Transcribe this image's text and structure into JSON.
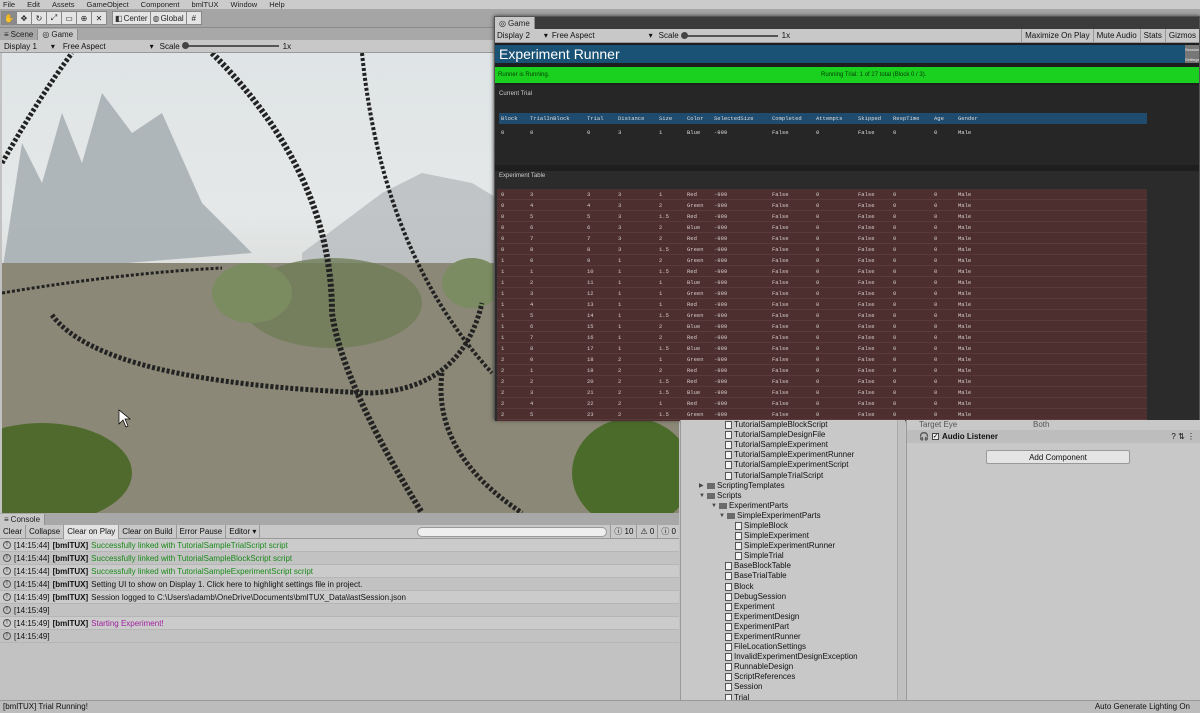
{
  "menu": [
    "File",
    "Edit",
    "Assets",
    "GameObject",
    "Component",
    "bmlTUX",
    "Window",
    "Help"
  ],
  "toolbar": {
    "center": "Center",
    "global": "Global"
  },
  "scene": {
    "tabs": [
      "Scene",
      "Game"
    ],
    "display": "Display 1",
    "aspect": "Free Aspect",
    "scale_label": "Scale",
    "scale_value": "1x"
  },
  "game": {
    "tab": "Game",
    "display": "Display 2",
    "aspect": "Free Aspect",
    "scale_label": "Scale",
    "scale_value": "1x",
    "buttons": [
      "Maximize On Play",
      "Mute Audio",
      "Stats",
      "Gizmos"
    ],
    "title": "Experiment Runner",
    "settings_btn": "Session Settings",
    "status_left": "Runner is Running.",
    "status_center": "Running Trial: 1 of 27 total (Block 0 / 3).",
    "current_trial_label": "Current Trial",
    "experiment_table_label": "Experiment Table",
    "columns": [
      "Block",
      "TrialInBlock",
      "Trial",
      "Distance",
      "Size",
      "Color",
      "SelectedSize",
      "Completed",
      "Attempts",
      "Skipped",
      "RespTime",
      "Age",
      "Gender"
    ],
    "current_row": [
      "0",
      "0",
      "0",
      "3",
      "1",
      "Blue",
      "-999",
      "False",
      "0",
      "False",
      "0",
      "0",
      "Male"
    ],
    "table_rows": [
      [
        "0",
        "3",
        "3",
        "3",
        "1",
        "Red",
        "-999",
        "False",
        "0",
        "False",
        "0",
        "0",
        "Male"
      ],
      [
        "0",
        "4",
        "4",
        "3",
        "2",
        "Green",
        "-999",
        "False",
        "0",
        "False",
        "0",
        "0",
        "Male"
      ],
      [
        "0",
        "5",
        "5",
        "3",
        "1.5",
        "Red",
        "-999",
        "False",
        "0",
        "False",
        "0",
        "0",
        "Male"
      ],
      [
        "0",
        "6",
        "6",
        "3",
        "2",
        "Blue",
        "-999",
        "False",
        "0",
        "False",
        "0",
        "0",
        "Male"
      ],
      [
        "0",
        "7",
        "7",
        "3",
        "2",
        "Red",
        "-999",
        "False",
        "0",
        "False",
        "0",
        "0",
        "Male"
      ],
      [
        "0",
        "8",
        "8",
        "3",
        "1.5",
        "Green",
        "-999",
        "False",
        "0",
        "False",
        "0",
        "0",
        "Male"
      ],
      [
        "1",
        "0",
        "9",
        "1",
        "2",
        "Green",
        "-999",
        "False",
        "0",
        "False",
        "0",
        "0",
        "Male"
      ],
      [
        "1",
        "1",
        "10",
        "1",
        "1.5",
        "Red",
        "-999",
        "False",
        "0",
        "False",
        "0",
        "0",
        "Male"
      ],
      [
        "1",
        "2",
        "11",
        "1",
        "1",
        "Blue",
        "-999",
        "False",
        "0",
        "False",
        "0",
        "0",
        "Male"
      ],
      [
        "1",
        "3",
        "12",
        "1",
        "1",
        "Green",
        "-999",
        "False",
        "0",
        "False",
        "0",
        "0",
        "Male"
      ],
      [
        "1",
        "4",
        "13",
        "1",
        "1",
        "Red",
        "-999",
        "False",
        "0",
        "False",
        "0",
        "0",
        "Male"
      ],
      [
        "1",
        "5",
        "14",
        "1",
        "1.5",
        "Green",
        "-999",
        "False",
        "0",
        "False",
        "0",
        "0",
        "Male"
      ],
      [
        "1",
        "6",
        "15",
        "1",
        "2",
        "Blue",
        "-999",
        "False",
        "0",
        "False",
        "0",
        "0",
        "Male"
      ],
      [
        "1",
        "7",
        "16",
        "1",
        "2",
        "Red",
        "-999",
        "False",
        "0",
        "False",
        "0",
        "0",
        "Male"
      ],
      [
        "1",
        "8",
        "17",
        "1",
        "1.5",
        "Blue",
        "-999",
        "False",
        "0",
        "False",
        "0",
        "0",
        "Male"
      ],
      [
        "2",
        "0",
        "18",
        "2",
        "1",
        "Green",
        "-999",
        "False",
        "0",
        "False",
        "0",
        "0",
        "Male"
      ],
      [
        "2",
        "1",
        "19",
        "2",
        "2",
        "Red",
        "-999",
        "False",
        "0",
        "False",
        "0",
        "0",
        "Male"
      ],
      [
        "2",
        "2",
        "20",
        "2",
        "1.5",
        "Red",
        "-999",
        "False",
        "0",
        "False",
        "0",
        "0",
        "Male"
      ],
      [
        "2",
        "3",
        "21",
        "2",
        "1.5",
        "Blue",
        "-999",
        "False",
        "0",
        "False",
        "0",
        "0",
        "Male"
      ],
      [
        "2",
        "4",
        "22",
        "2",
        "1",
        "Red",
        "-999",
        "False",
        "0",
        "False",
        "0",
        "0",
        "Male"
      ],
      [
        "2",
        "5",
        "23",
        "2",
        "1.5",
        "Green",
        "-999",
        "False",
        "0",
        "False",
        "0",
        "0",
        "Male"
      ]
    ]
  },
  "console": {
    "tab": "Console",
    "buttons": [
      "Clear",
      "Collapse",
      "Clear on Play",
      "Clear on Build",
      "Error Pause",
      "Editor"
    ],
    "counts": [
      "10",
      "0",
      "0"
    ],
    "lines": [
      {
        "time": "[14:15:44]",
        "tag": "[bmlTUX]",
        "msg": "Successfully linked with TutorialSampleTrialScript script",
        "color": "#1a8a1a"
      },
      {
        "time": "[14:15:44]",
        "tag": "[bmlTUX]",
        "msg": "Successfully linked with TutorialSampleBlockScript script",
        "color": "#1a8a1a"
      },
      {
        "time": "[14:15:44]",
        "tag": "[bmlTUX]",
        "msg": "Successfully linked with TutorialSampleExperimentScript script",
        "color": "#1a8a1a"
      },
      {
        "time": "[14:15:44]",
        "tag": "[bmlTUX]",
        "msg": "Setting UI to show on Display 1. Click here to highlight settings file in project.",
        "color": "#111111"
      },
      {
        "time": "[14:15:49]",
        "tag": "[bmlTUX]",
        "msg": "Session logged to C:\\Users\\adamb\\OneDrive\\Documents\\bmlTUX_Data\\lastSession.json",
        "color": "#111111"
      },
      {
        "time": "[14:15:49]",
        "tag": "",
        "msg": "",
        "color": "#111111"
      },
      {
        "time": "[14:15:49]",
        "tag": "[bmlTUX]",
        "msg": "Starting Experiment!",
        "color": "#a020a0"
      },
      {
        "time": "[14:15:49]",
        "tag": "",
        "msg": "",
        "color": "#111111"
      }
    ]
  },
  "project": {
    "items": [
      {
        "label": "TutorialSampleBlockScript",
        "indent": 44,
        "kind": "file"
      },
      {
        "label": "TutorialSampleDesignFile",
        "indent": 44,
        "kind": "file"
      },
      {
        "label": "TutorialSampleExperiment",
        "indent": 44,
        "kind": "file"
      },
      {
        "label": "TutorialSampleExperimentRunner",
        "indent": 44,
        "kind": "file"
      },
      {
        "label": "TutorialSampleExperimentScript",
        "indent": 44,
        "kind": "file"
      },
      {
        "label": "TutorialSampleTrialScript",
        "indent": 44,
        "kind": "file"
      },
      {
        "label": "ScriptingTemplates",
        "indent": 18,
        "kind": "folder",
        "arrow": "▶"
      },
      {
        "label": "Scripts",
        "indent": 18,
        "kind": "folder",
        "arrow": "▼"
      },
      {
        "label": "ExperimentParts",
        "indent": 30,
        "kind": "folder",
        "arrow": "▼"
      },
      {
        "label": "SimpleExperimentParts",
        "indent": 38,
        "kind": "folder",
        "arrow": "▼"
      },
      {
        "label": "SimpleBlock",
        "indent": 54,
        "kind": "file"
      },
      {
        "label": "SimpleExperiment",
        "indent": 54,
        "kind": "file"
      },
      {
        "label": "SimpleExperimentRunner",
        "indent": 54,
        "kind": "file"
      },
      {
        "label": "SimpleTrial",
        "indent": 54,
        "kind": "file"
      },
      {
        "label": "BaseBlockTable",
        "indent": 44,
        "kind": "file"
      },
      {
        "label": "BaseTrialTable",
        "indent": 44,
        "kind": "file"
      },
      {
        "label": "Block",
        "indent": 44,
        "kind": "file"
      },
      {
        "label": "DebugSession",
        "indent": 44,
        "kind": "file"
      },
      {
        "label": "Experiment",
        "indent": 44,
        "kind": "file"
      },
      {
        "label": "ExperimentDesign",
        "indent": 44,
        "kind": "file"
      },
      {
        "label": "ExperimentPart",
        "indent": 44,
        "kind": "file"
      },
      {
        "label": "ExperimentRunner",
        "indent": 44,
        "kind": "file"
      },
      {
        "label": "FileLocationSettings",
        "indent": 44,
        "kind": "file"
      },
      {
        "label": "InvalidExperimentDesignException",
        "indent": 44,
        "kind": "file"
      },
      {
        "label": "RunnableDesign",
        "indent": 44,
        "kind": "file"
      },
      {
        "label": "ScriptReferences",
        "indent": 44,
        "kind": "file"
      },
      {
        "label": "Session",
        "indent": 44,
        "kind": "file"
      },
      {
        "label": "Trial",
        "indent": 44,
        "kind": "file"
      }
    ]
  },
  "inspector": {
    "target_eye": "Target Eye",
    "target_eye_value": "Both",
    "audio_listener": "Audio Listener",
    "add_component": "Add Component"
  },
  "statusbar": {
    "left": "[bmlTUX] Trial Running!",
    "right": "Auto Generate Lighting On"
  },
  "colors": {
    "status_green": "#19d11e",
    "title_blue": "#1a5276",
    "table_red": "#4d2f2f"
  }
}
